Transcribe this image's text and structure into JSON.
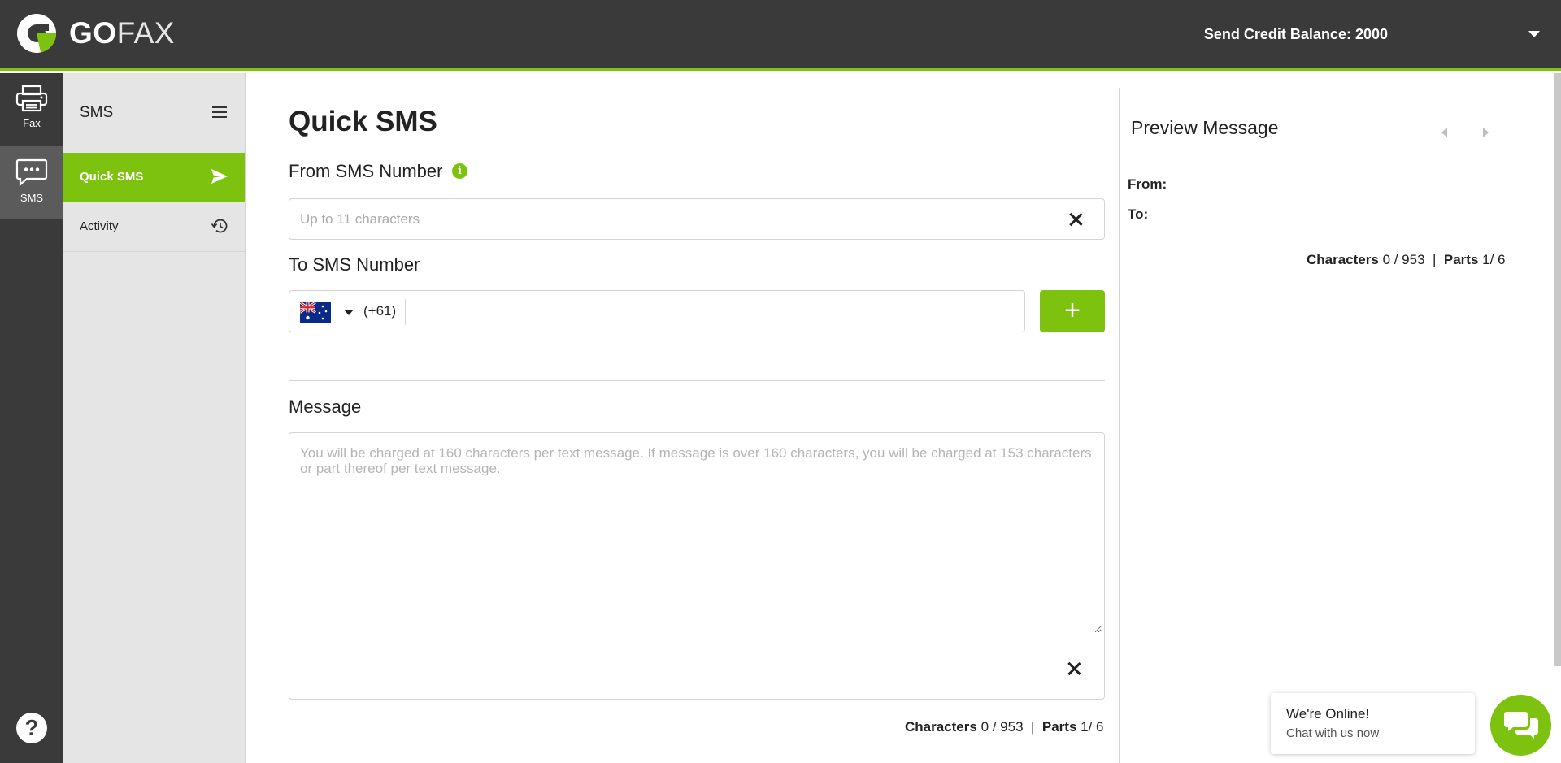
{
  "app": {
    "logo_go": "GO",
    "logo_fax": "FAX",
    "credit_balance": "Send Credit Balance: 2000"
  },
  "rail": {
    "items": [
      {
        "label": "Fax",
        "icon": "printer-icon"
      },
      {
        "label": "SMS",
        "icon": "chat-icon"
      }
    ],
    "help": "?"
  },
  "subnav": {
    "title": "SMS",
    "items": [
      {
        "label": "Quick SMS",
        "icon": "send-icon",
        "active": true
      },
      {
        "label": "Activity",
        "icon": "history-icon",
        "active": false
      }
    ]
  },
  "form": {
    "title": "Quick SMS",
    "from_label": "From SMS Number",
    "from_info_icon": "i",
    "from_placeholder": "Up to 11 characters",
    "from_value": "",
    "to_label": "To SMS Number",
    "to_country": "Australia",
    "to_dial_code": "(+61)",
    "to_value": "",
    "add_label": "+",
    "message_label": "Message",
    "message_placeholder": "You will be charged at 160 characters per text message. If message is over 160 characters, you will be charged at 153 characters or part thereof per text message.",
    "message_value": "",
    "counter": {
      "characters_label": "Characters",
      "characters_value": "0 / 953",
      "separator": "|",
      "parts_label": "Parts",
      "parts_value": "1/ 6"
    }
  },
  "preview": {
    "title": "Preview Message",
    "from_label": "From:",
    "to_label": "To:",
    "counter": {
      "characters_label": "Characters",
      "characters_value": "0 / 953",
      "separator": "|",
      "parts_label": "Parts",
      "parts_value": "1/ 6"
    }
  },
  "chat": {
    "title": "We're Online!",
    "subtitle": "Chat with us now"
  },
  "colors": {
    "accent": "#7cc20f",
    "topbar": "#3a3a3a",
    "sidebar": "#e5e5e5"
  }
}
